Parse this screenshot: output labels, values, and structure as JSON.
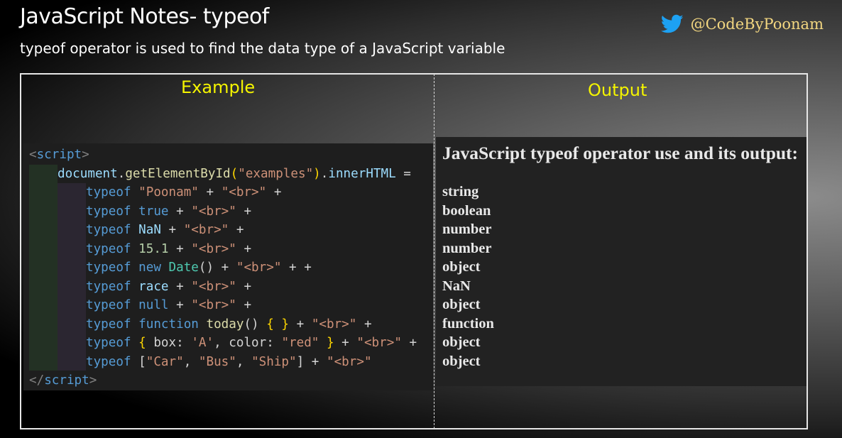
{
  "header": {
    "title": "JavaScript Notes- typeof",
    "subtitle": "typeof operator is used to find the data type of a JavaScript variable",
    "handle": "@CodeByPoonam",
    "handle_icon": "twitter-icon"
  },
  "example": {
    "title": "Example",
    "code": {
      "open_tag_lt": "<",
      "open_tag_name": "script",
      "open_tag_gt": ">",
      "line1_obj": "document",
      "line1_dot": ".",
      "line1_fn": "getElementById",
      "line1_paren_open": "(",
      "line1_arg": "\"examples\"",
      "line1_paren_close": ")",
      "line1_dot2": ".",
      "line1_prop": "innerHTML",
      "line1_eq": " =",
      "typeof_kw": "typeof",
      "br_str": "\"<br>\"",
      "plus": " + ",
      "plus_tail": " +",
      "l2_val": "\"Poonam\"",
      "l3_val": "true",
      "l4_val": "NaN",
      "l5_val": "15.1",
      "l6_new": "new",
      "l6_cls": "Date",
      "l6_call": "()",
      "l6_tail": " + +",
      "l7_val": "race",
      "l8_val": "null",
      "l9_kw": "function",
      "l9_fn": "today",
      "l9_call": "()",
      "l9_body": "{ }",
      "l10_open": "{",
      "l10_k1": " box: ",
      "l10_v1": "'A'",
      "l10_k2": ", color: ",
      "l10_v2": "\"red\"",
      "l10_close": "}",
      "l11_open": "[",
      "l11_v1": "\"Car\"",
      "l11_sep": ", ",
      "l11_v2": "\"Bus\"",
      "l11_v3": "\"Ship\"",
      "l11_close": "]",
      "close_tag_lt": "</",
      "close_tag_name": "script",
      "close_tag_gt": ">"
    }
  },
  "output": {
    "title": "Output",
    "heading": "JavaScript typeof operator use and its output:",
    "results": [
      "string",
      "boolean",
      "number",
      "number",
      "object",
      "NaN",
      "object",
      "function",
      "object",
      "object"
    ]
  },
  "colors": {
    "accent_yellow": "#f4f400",
    "handle_gold": "#f2d680",
    "twitter_blue": "#1da1f2"
  }
}
